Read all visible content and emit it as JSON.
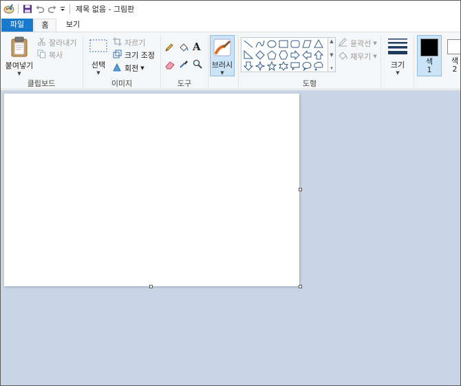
{
  "title_bar": {
    "title": "제목 없음 - 그림판"
  },
  "tabs": [
    {
      "label": "파일"
    },
    {
      "label": "홈"
    },
    {
      "label": "보기"
    }
  ],
  "ribbon": {
    "clipboard": {
      "paste_label": "붙여넣기",
      "cut_label": "잘라내기",
      "copy_label": "복사",
      "group_label": "클립보드"
    },
    "image": {
      "select_label": "선택",
      "crop_label": "자르기",
      "resize_label": "크기 조정",
      "rotate_label": "회전",
      "group_label": "이미지"
    },
    "tools": {
      "group_label": "도구"
    },
    "brushes": {
      "label": "브러시"
    },
    "shapes": {
      "outline_label": "윤곽선",
      "fill_label": "채우기",
      "group_label": "도형"
    },
    "size": {
      "label": "크기"
    },
    "colors": {
      "color1_label": "색\n1",
      "color1_line1": "색",
      "color1_line2": "1",
      "color2_line1": "색",
      "color2_line2": "2",
      "color1_value": "#000000",
      "color2_value": "#ffffff"
    }
  },
  "colors": {
    "accent": "#1979ca",
    "workspace_bg": "#c9d4e4",
    "ribbon_bg": "#f5f6f7",
    "selected_bg": "#cce4f7"
  },
  "icons": [
    "paint-app-icon",
    "save-icon",
    "undo-icon",
    "redo-icon",
    "customize-qa-icon",
    "paste-icon",
    "scissors-icon",
    "copy-icon",
    "select-icon",
    "crop-icon",
    "resize-icon",
    "rotate-icon",
    "pencil-icon",
    "fill-bucket-icon",
    "text-icon",
    "eraser-icon",
    "color-picker-icon",
    "magnifier-icon",
    "brush-icon",
    "outline-icon",
    "fill-icon",
    "size-lines-icon"
  ]
}
